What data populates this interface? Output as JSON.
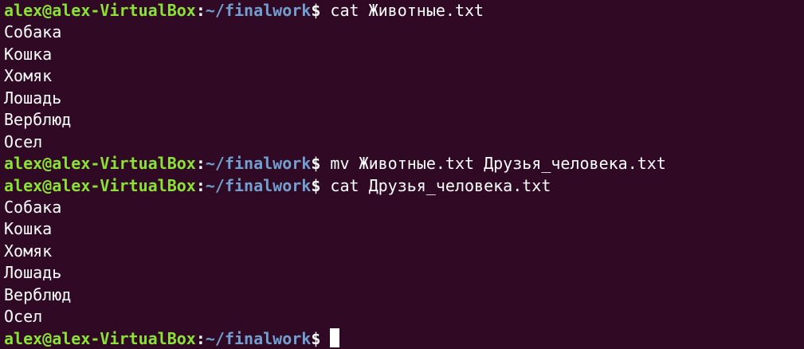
{
  "prompt": {
    "user_host": "alex@alex-VirtualBox",
    "colon": ":",
    "path": "~/finalwork",
    "dollar": "$ "
  },
  "lines": [
    {
      "type": "prompt",
      "command": "cat Животные.txt"
    },
    {
      "type": "output",
      "text": "Собака"
    },
    {
      "type": "output",
      "text": "Кошка"
    },
    {
      "type": "output",
      "text": "Хомяк"
    },
    {
      "type": "output",
      "text": "Лошадь"
    },
    {
      "type": "output",
      "text": "Верблюд"
    },
    {
      "type": "output",
      "text": "Осел"
    },
    {
      "type": "prompt",
      "command": "mv Животные.txt Друзья_человека.txt"
    },
    {
      "type": "prompt",
      "command": "cat Друзья_человека.txt"
    },
    {
      "type": "output",
      "text": "Собака"
    },
    {
      "type": "output",
      "text": "Кошка"
    },
    {
      "type": "output",
      "text": "Хомяк"
    },
    {
      "type": "output",
      "text": "Лошадь"
    },
    {
      "type": "output",
      "text": "Верблюд"
    },
    {
      "type": "output",
      "text": "Осел"
    },
    {
      "type": "prompt",
      "command": "",
      "cursor": true
    }
  ]
}
